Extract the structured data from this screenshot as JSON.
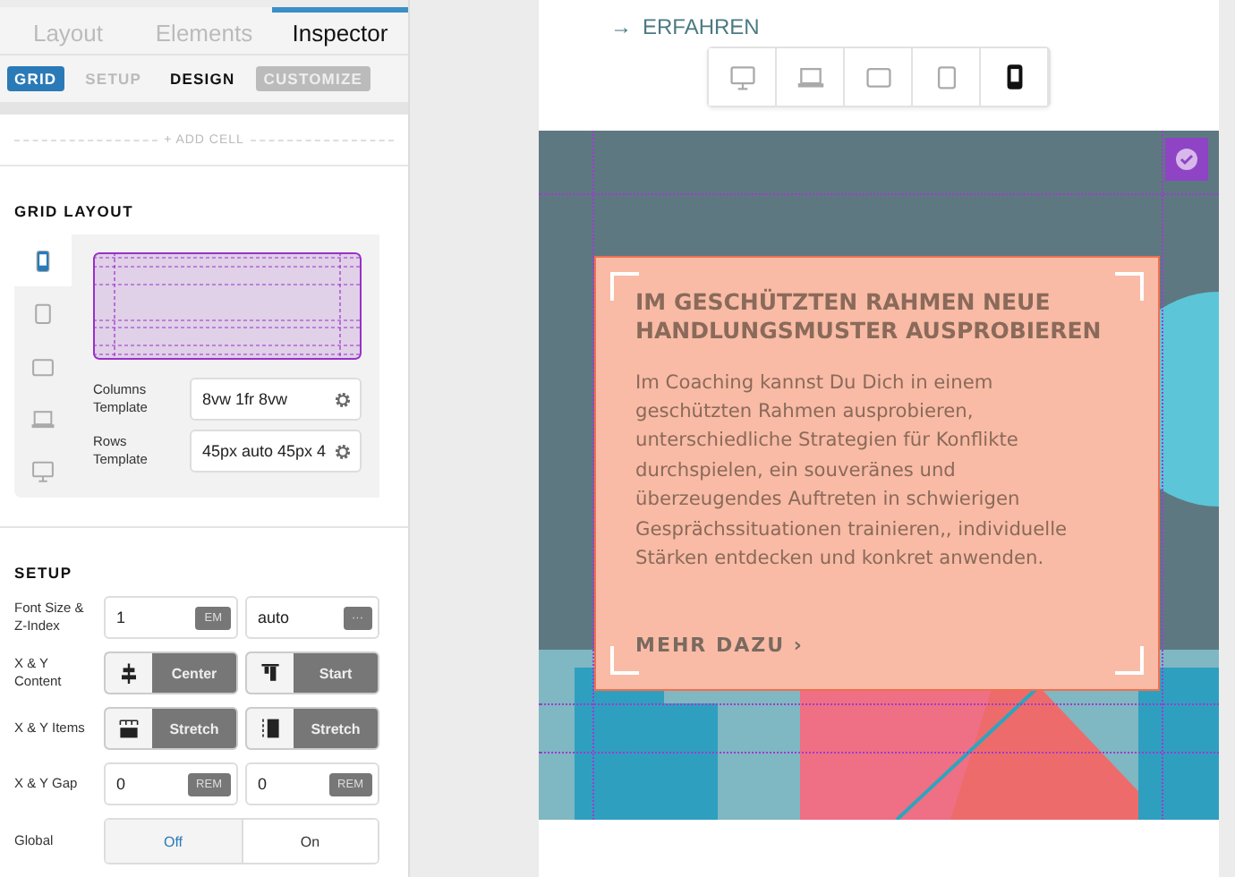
{
  "main_tabs": [
    {
      "label": "Layout",
      "selected": false
    },
    {
      "label": "Elements",
      "selected": false
    },
    {
      "label": "Inspector",
      "selected": true
    }
  ],
  "sub_tabs": [
    {
      "label": "GRID",
      "kind": "badge",
      "selected": true
    },
    {
      "label": "SETUP",
      "kind": "plain",
      "selected": false
    },
    {
      "label": "DESIGN",
      "kind": "plain",
      "selected": true
    },
    {
      "label": "CUSTOMIZE",
      "kind": "badge",
      "selected": false
    }
  ],
  "add_cell": "+ ADD CELL",
  "grid_layout": {
    "heading": "GRID LAYOUT",
    "devices": [
      {
        "kind": "phone",
        "selected": true
      },
      {
        "kind": "tablet",
        "selected": false
      },
      {
        "kind": "tablet-wide",
        "selected": false
      },
      {
        "kind": "laptop",
        "selected": false
      },
      {
        "kind": "desktop",
        "selected": false
      }
    ],
    "fields": [
      {
        "label": "Columns Template",
        "value": "8vw 1fr 8vw"
      },
      {
        "label": "Rows Template",
        "value": "45px auto 45px 4"
      }
    ]
  },
  "setup": {
    "heading": "SETUP",
    "rows": [
      {
        "label": "Font Size & Z-Index",
        "kind": "inputs",
        "cells": [
          {
            "value": "1",
            "unit": "EM"
          },
          {
            "value": "auto",
            "unit": "···"
          }
        ]
      },
      {
        "label": "X & Y Content",
        "kind": "selects",
        "cells": [
          {
            "kind": "center",
            "value": "Center"
          },
          {
            "kind": "start",
            "value": "Start"
          }
        ]
      },
      {
        "label": "X & Y Items",
        "kind": "selects",
        "cells": [
          {
            "kind": "stretch-x",
            "value": "Stretch"
          },
          {
            "kind": "stretch-y",
            "value": "Stretch"
          }
        ]
      },
      {
        "label": "X & Y Gap",
        "kind": "inputs",
        "cells": [
          {
            "value": "0",
            "unit": "REM"
          },
          {
            "value": "0",
            "unit": "REM"
          }
        ]
      },
      {
        "label": "Global",
        "kind": "toggle",
        "cells": [
          {
            "value": "Off",
            "selected": true
          },
          {
            "value": "On",
            "selected": false
          }
        ]
      }
    ]
  },
  "preview": {
    "link": {
      "arrow": "→",
      "text": "ERFAHREN"
    },
    "devices": [
      {
        "kind": "desktop",
        "selected": false
      },
      {
        "kind": "laptop",
        "selected": false
      },
      {
        "kind": "tablet-wide",
        "selected": false
      },
      {
        "kind": "tablet",
        "selected": false
      },
      {
        "kind": "phone",
        "selected": true
      }
    ],
    "card": {
      "title": "IM GESCHÜTZTEN RAHMEN NEUE HANDLUNGSMUSTER AUSPROBIEREN",
      "body": "Im Coaching kannst Du Dich in einem geschützten Rahmen ausprobieren, unterschiedliche Strategien für Konflikte durchspielen, ein souveränes und überzeugendes Auftreten in schwierigen Gesprächssituationen trainieren,, individuelle Stärken entdecken und konkret anwenden.",
      "link": "MEHR DAZU ›"
    }
  }
}
